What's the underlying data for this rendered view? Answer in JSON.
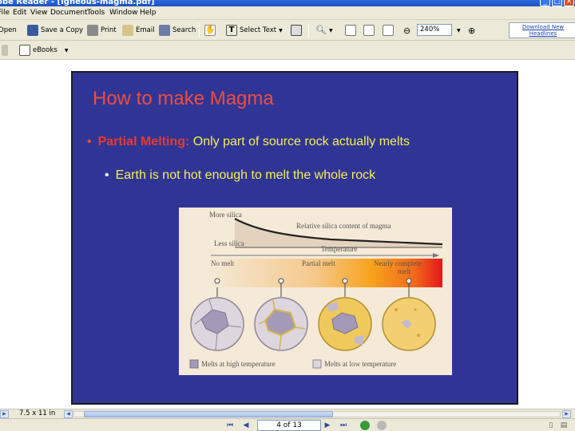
{
  "window": {
    "title": "obe Reader - [Igneous-magma.pdf]"
  },
  "menu": [
    "File",
    "Edit",
    "View",
    "Document",
    "Tools",
    "Window",
    "Help"
  ],
  "toolbar": {
    "open": "Open",
    "save_copy": "Save a Copy",
    "print": "Print",
    "email": "Email",
    "search": "Search",
    "select_text": "Select Text",
    "zoom": "240%",
    "download_new_headlines": "Download New Headlines",
    "ebooks": "eBooks"
  },
  "slide": {
    "title": "How to make Magma",
    "bullet1_term": "Partial Melting:",
    "bullet1_text": " Only part of source rock actually melts",
    "bullet2": "Earth is not hot enough to melt the whole rock"
  },
  "figure": {
    "more_silica": "More silica",
    "less_silica": "Less silica",
    "curve_label": "Relative silica content of magma",
    "temperature": "Temperature",
    "no_melt": "No melt",
    "partial_melt": "Partial melt",
    "nearly_complete": "Nearly complete",
    "melt": "melt",
    "legend_high": "Melts at high temperature",
    "legend_low": "Melts at low temperature"
  },
  "status": {
    "page_size": "7.5 x 11 in",
    "page_indicator": "4 of 13"
  },
  "colors": {
    "slide_bg": "#303595",
    "title_red": "#ef4d3c",
    "bullet_yellow": "#f7ee55",
    "chrome": "#ece9d8"
  }
}
